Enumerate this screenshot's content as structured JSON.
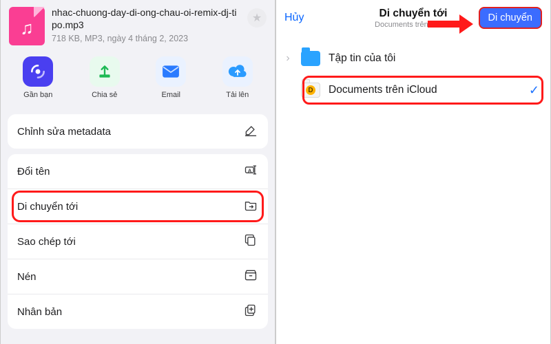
{
  "left": {
    "file": {
      "name": "nhac-chuong-day-di-ong-chau-oi-remix-dj-tipo.mp3",
      "sub": "718 KB, MP3, ngày 4 tháng 2, 2023"
    },
    "share": {
      "near": "Gần bạn",
      "share": "Chia sẻ",
      "email": "Email",
      "upload": "Tải lên"
    },
    "actions": {
      "metadata": "Chỉnh sửa metadata",
      "rename": "Đổi tên",
      "moveto": "Di chuyển tới",
      "copyto": "Sao chép tới",
      "compress": "Nén",
      "duplicate": "Nhân bản"
    }
  },
  "right": {
    "cancel": "Hủy",
    "title": "Di chuyển tới",
    "subtitle": "Documents trên iCloud",
    "move": "Di chuyển",
    "loc1": "Tập tin của tôi",
    "loc2": "Documents trên iCloud"
  }
}
